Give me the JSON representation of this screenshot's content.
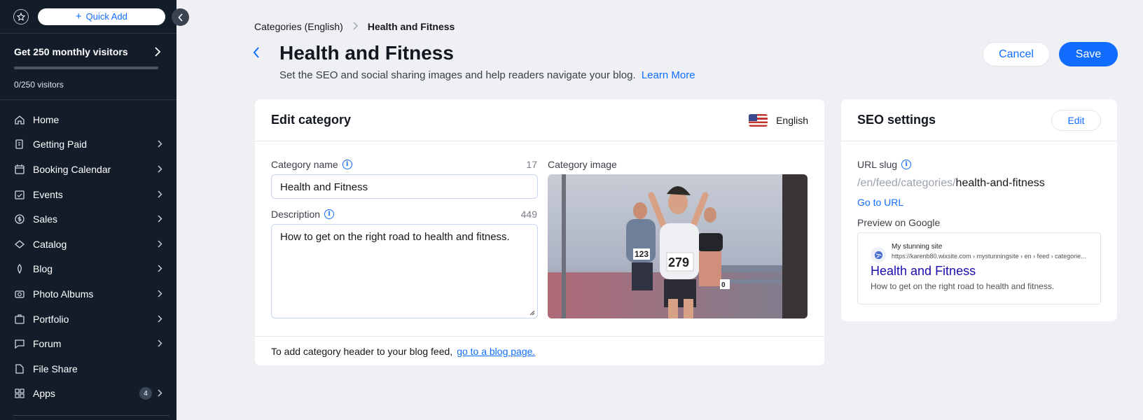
{
  "sidebar": {
    "quick_add_label": "Quick Add",
    "promo": {
      "title": "Get 250 monthly visitors",
      "progress": 0,
      "count_text": "0/250 visitors"
    },
    "items": [
      {
        "label": "Home",
        "icon": "home-icon",
        "chevron": false
      },
      {
        "label": "Getting Paid",
        "icon": "getting-paid-icon",
        "chevron": true
      },
      {
        "label": "Booking Calendar",
        "icon": "calendar-icon",
        "chevron": true
      },
      {
        "label": "Events",
        "icon": "events-icon",
        "chevron": true
      },
      {
        "label": "Sales",
        "icon": "sales-icon",
        "chevron": true
      },
      {
        "label": "Catalog",
        "icon": "catalog-icon",
        "chevron": true
      },
      {
        "label": "Blog",
        "icon": "blog-icon",
        "chevron": true
      },
      {
        "label": "Photo Albums",
        "icon": "camera-icon",
        "chevron": true
      },
      {
        "label": "Portfolio",
        "icon": "portfolio-icon",
        "chevron": true
      },
      {
        "label": "Forum",
        "icon": "forum-icon",
        "chevron": true
      },
      {
        "label": "File Share",
        "icon": "file-icon",
        "chevron": false
      },
      {
        "label": "Apps",
        "icon": "apps-icon",
        "chevron": true,
        "badge": "4"
      }
    ]
  },
  "breadcrumb": {
    "parent": "Categories (English)",
    "current": "Health and Fitness"
  },
  "header": {
    "title": "Health and Fitness",
    "subtitle": "Set the SEO and social sharing images and help readers navigate your blog.",
    "learn_more": "Learn More",
    "cancel_label": "Cancel",
    "save_label": "Save"
  },
  "edit_category": {
    "title": "Edit category",
    "language": "English",
    "name_label": "Category name",
    "name_count": "17",
    "name_value": "Health and Fitness",
    "description_label": "Description",
    "description_count": "449",
    "description_value": "How to get on the right road to health and fitness.",
    "image_label": "Category image",
    "image_bibs": [
      "123",
      "279",
      "0"
    ],
    "footer_text": "To add category header to your blog feed,",
    "footer_link": "go to a blog page."
  },
  "seo": {
    "title": "SEO settings",
    "edit_label": "Edit",
    "url_slug_label": "URL slug",
    "slug_prefix": "/en/feed/categories/",
    "slug_value": "health-and-fitness",
    "go_to_url": "Go to URL",
    "preview_label": "Preview on Google",
    "google": {
      "site_name": "My stunning site",
      "url": "https://karenb80.wixsite.com › mystunningsite › en › feed › categorie...",
      "title": "Health and Fitness",
      "description": "How to get on the right road to health and fitness."
    }
  },
  "colors": {
    "accent": "#116dff",
    "sidebar_bg": "#131d2a",
    "page_bg": "#eef0f4"
  }
}
